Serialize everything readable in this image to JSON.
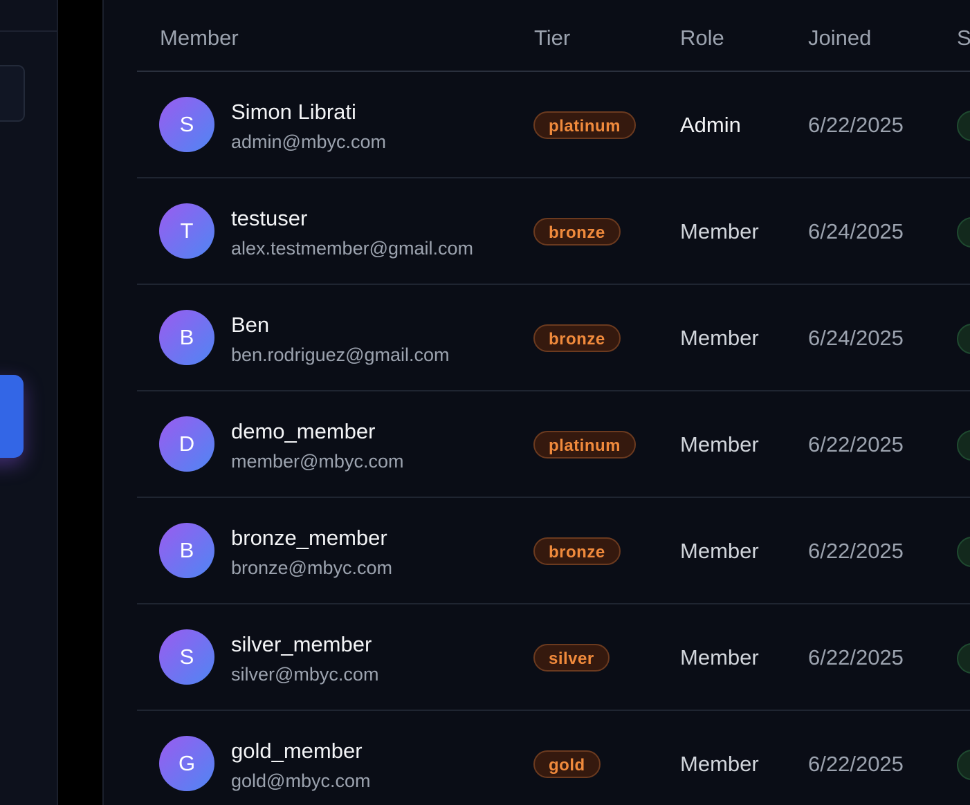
{
  "table": {
    "headers": {
      "member": "Member",
      "tier": "Tier",
      "role": "Role",
      "joined": "Joined",
      "status": "S"
    },
    "rows": [
      {
        "initial": "S",
        "name": "Simon Librati",
        "email": "admin@mbyc.com",
        "tier": "platinum",
        "role": "Admin",
        "joined": "6/22/2025"
      },
      {
        "initial": "T",
        "name": "testuser",
        "email": "alex.testmember@gmail.com",
        "tier": "bronze",
        "role": "Member",
        "joined": "6/24/2025"
      },
      {
        "initial": "B",
        "name": "Ben",
        "email": "ben.rodriguez@gmail.com",
        "tier": "bronze",
        "role": "Member",
        "joined": "6/24/2025"
      },
      {
        "initial": "D",
        "name": "demo_member",
        "email": "member@mbyc.com",
        "tier": "platinum",
        "role": "Member",
        "joined": "6/22/2025"
      },
      {
        "initial": "B",
        "name": "bronze_member",
        "email": "bronze@mbyc.com",
        "tier": "bronze",
        "role": "Member",
        "joined": "6/22/2025"
      },
      {
        "initial": "S",
        "name": "silver_member",
        "email": "silver@mbyc.com",
        "tier": "silver",
        "role": "Member",
        "joined": "6/22/2025"
      },
      {
        "initial": "G",
        "name": "gold_member",
        "email": "gold@mbyc.com",
        "tier": "gold",
        "role": "Member",
        "joined": "6/22/2025"
      }
    ]
  },
  "colors": {
    "background": "#0a0d16",
    "accent": "#3366e6",
    "badge_text": "#f08a3c",
    "badge_bg": "#35190e",
    "status_bg": "#13291d",
    "admin_role_text": "#f3f4f6",
    "member_role_text": "#d1d5db"
  }
}
